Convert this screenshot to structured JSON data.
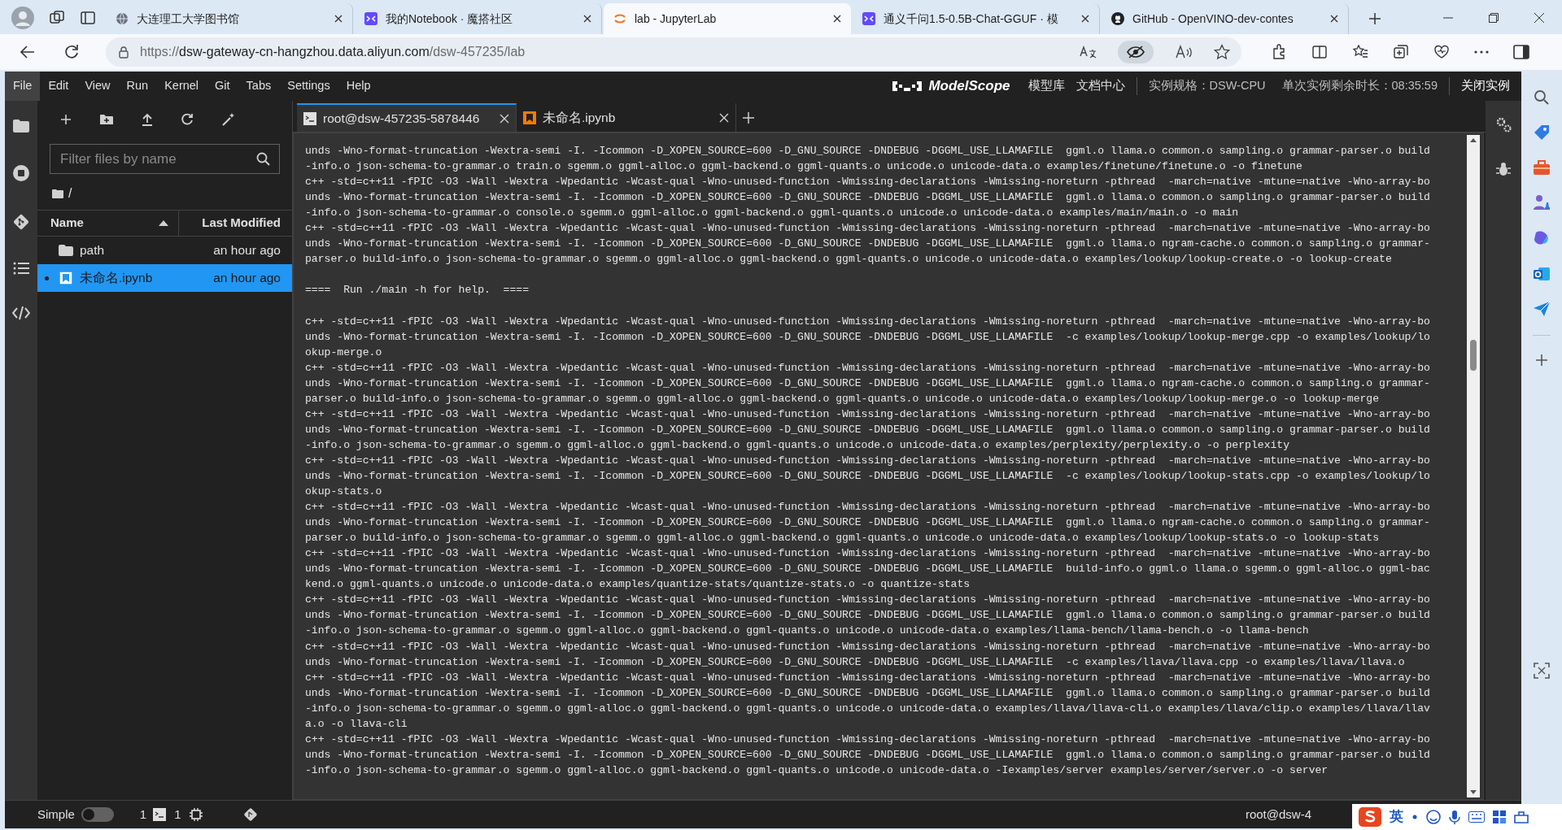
{
  "browser": {
    "tabs": [
      {
        "kind": "globe",
        "title": "大连理工大学图书馆",
        "selected": false
      },
      {
        "kind": "modelscope",
        "title": "我的Notebook · 魔搭社区",
        "selected": false
      },
      {
        "kind": "jupyter",
        "title": "lab - JupyterLab",
        "selected": true
      },
      {
        "kind": "modelscope",
        "title": "通义千问1.5-0.5B-Chat-GGUF · 模",
        "selected": false
      },
      {
        "kind": "github",
        "title": "GitHub - OpenVINO-dev-contes",
        "selected": false
      }
    ],
    "url": {
      "scheme": "https://",
      "host": "dsw-gateway-cn-hangzhou.data.aliyun.com",
      "path": "/dsw-457235/lab"
    }
  },
  "jupyter": {
    "menu": [
      {
        "label": "File",
        "selected": true
      },
      {
        "label": "Edit",
        "selected": false
      },
      {
        "label": "View",
        "selected": false
      },
      {
        "label": "Run",
        "selected": false
      },
      {
        "label": "Kernel",
        "selected": false
      },
      {
        "label": "Git",
        "selected": false
      },
      {
        "label": "Tabs",
        "selected": false
      },
      {
        "label": "Settings",
        "selected": false
      },
      {
        "label": "Help",
        "selected": false
      }
    ],
    "brand": {
      "logo_text": "ModelScope",
      "links": [
        "模型库",
        "文档中心"
      ],
      "instance_spec": "实例规格：DSW-CPU",
      "remaining_time": "单次实例剩余时长：08:35:59",
      "close_button": "关闭实例"
    },
    "file_browser": {
      "filter_placeholder": "Filter files by name",
      "path": "/",
      "columns": [
        "Name",
        "Last Modified"
      ],
      "files": [
        {
          "kind": "folder",
          "name": "path",
          "modified": "an hour ago",
          "selected": false,
          "running": false
        },
        {
          "kind": "notebook",
          "name": "未命名.ipynb",
          "modified": "an hour ago",
          "selected": true,
          "running": true
        }
      ]
    },
    "tabs": [
      {
        "kind": "terminal",
        "title": "root@dsw-457235-5878446",
        "selected": true
      },
      {
        "kind": "notebook",
        "title": "未命名.ipynb",
        "selected": false
      }
    ],
    "terminal": {
      "blocks": [
        [
          "unds -Wno-format-truncation -Wextra-semi -I. -Icommon -D_XOPEN_SOURCE=600 -D_GNU_SOURCE -DNDEBUG -DGGML_USE_LLAMAFILE  ggml.o llama.o common.o sampling.o grammar-parser.o build",
          "-info.o json-schema-to-grammar.o train.o sgemm.o ggml-alloc.o ggml-backend.o ggml-quants.o unicode.o unicode-data.o examples/finetune/finetune.o -o finetune",
          "c++ -std=c++11 -fPIC -O3 -Wall -Wextra -Wpedantic -Wcast-qual -Wno-unused-function -Wmissing-declarations -Wmissing-noreturn -pthread  -march=native -mtune=native -Wno-array-bo",
          "unds -Wno-format-truncation -Wextra-semi -I. -Icommon -D_XOPEN_SOURCE=600 -D_GNU_SOURCE -DNDEBUG -DGGML_USE_LLAMAFILE  ggml.o llama.o common.o sampling.o grammar-parser.o build",
          "-info.o json-schema-to-grammar.o console.o sgemm.o ggml-alloc.o ggml-backend.o ggml-quants.o unicode.o unicode-data.o examples/main/main.o -o main",
          "c++ -std=c++11 -fPIC -O3 -Wall -Wextra -Wpedantic -Wcast-qual -Wno-unused-function -Wmissing-declarations -Wmissing-noreturn -pthread  -march=native -mtune=native -Wno-array-bo",
          "unds -Wno-format-truncation -Wextra-semi -I. -Icommon -D_XOPEN_SOURCE=600 -D_GNU_SOURCE -DNDEBUG -DGGML_USE_LLAMAFILE  ggml.o llama.o ngram-cache.o common.o sampling.o grammar-",
          "parser.o build-info.o json-schema-to-grammar.o sgemm.o ggml-alloc.o ggml-backend.o ggml-quants.o unicode.o unicode-data.o examples/lookup/lookup-create.o -o lookup-create"
        ],
        [
          "====  Run ./main -h for help.  ===="
        ],
        [
          "c++ -std=c++11 -fPIC -O3 -Wall -Wextra -Wpedantic -Wcast-qual -Wno-unused-function -Wmissing-declarations -Wmissing-noreturn -pthread  -march=native -mtune=native -Wno-array-bo",
          "unds -Wno-format-truncation -Wextra-semi -I. -Icommon -D_XOPEN_SOURCE=600 -D_GNU_SOURCE -DNDEBUG -DGGML_USE_LLAMAFILE  -c examples/lookup/lookup-merge.cpp -o examples/lookup/lo",
          "okup-merge.o",
          "c++ -std=c++11 -fPIC -O3 -Wall -Wextra -Wpedantic -Wcast-qual -Wno-unused-function -Wmissing-declarations -Wmissing-noreturn -pthread  -march=native -mtune=native -Wno-array-bo",
          "unds -Wno-format-truncation -Wextra-semi -I. -Icommon -D_XOPEN_SOURCE=600 -D_GNU_SOURCE -DNDEBUG -DGGML_USE_LLAMAFILE  ggml.o llama.o ngram-cache.o common.o sampling.o grammar-",
          "parser.o build-info.o json-schema-to-grammar.o sgemm.o ggml-alloc.o ggml-backend.o ggml-quants.o unicode.o unicode-data.o examples/lookup/lookup-merge.o -o lookup-merge",
          "c++ -std=c++11 -fPIC -O3 -Wall -Wextra -Wpedantic -Wcast-qual -Wno-unused-function -Wmissing-declarations -Wmissing-noreturn -pthread  -march=native -mtune=native -Wno-array-bo",
          "unds -Wno-format-truncation -Wextra-semi -I. -Icommon -D_XOPEN_SOURCE=600 -D_GNU_SOURCE -DNDEBUG -DGGML_USE_LLAMAFILE  ggml.o llama.o common.o sampling.o grammar-parser.o build",
          "-info.o json-schema-to-grammar.o sgemm.o ggml-alloc.o ggml-backend.o ggml-quants.o unicode.o unicode-data.o examples/perplexity/perplexity.o -o perplexity",
          "c++ -std=c++11 -fPIC -O3 -Wall -Wextra -Wpedantic -Wcast-qual -Wno-unused-function -Wmissing-declarations -Wmissing-noreturn -pthread  -march=native -mtune=native -Wno-array-bo",
          "unds -Wno-format-truncation -Wextra-semi -I. -Icommon -D_XOPEN_SOURCE=600 -D_GNU_SOURCE -DNDEBUG -DGGML_USE_LLAMAFILE  -c examples/lookup/lookup-stats.cpp -o examples/lookup/lo",
          "okup-stats.o",
          "c++ -std=c++11 -fPIC -O3 -Wall -Wextra -Wpedantic -Wcast-qual -Wno-unused-function -Wmissing-declarations -Wmissing-noreturn -pthread  -march=native -mtune=native -Wno-array-bo",
          "unds -Wno-format-truncation -Wextra-semi -I. -Icommon -D_XOPEN_SOURCE=600 -D_GNU_SOURCE -DNDEBUG -DGGML_USE_LLAMAFILE  ggml.o llama.o ngram-cache.o common.o sampling.o grammar-",
          "parser.o build-info.o json-schema-to-grammar.o sgemm.o ggml-alloc.o ggml-backend.o ggml-quants.o unicode.o unicode-data.o examples/lookup/lookup-stats.o -o lookup-stats",
          "c++ -std=c++11 -fPIC -O3 -Wall -Wextra -Wpedantic -Wcast-qual -Wno-unused-function -Wmissing-declarations -Wmissing-noreturn -pthread  -march=native -mtune=native -Wno-array-bo",
          "unds -Wno-format-truncation -Wextra-semi -I. -Icommon -D_XOPEN_SOURCE=600 -D_GNU_SOURCE -DNDEBUG -DGGML_USE_LLAMAFILE  build-info.o ggml.o llama.o sgemm.o ggml-alloc.o ggml-bac",
          "kend.o ggml-quants.o unicode.o unicode-data.o examples/quantize-stats/quantize-stats.o -o quantize-stats",
          "c++ -std=c++11 -fPIC -O3 -Wall -Wextra -Wpedantic -Wcast-qual -Wno-unused-function -Wmissing-declarations -Wmissing-noreturn -pthread  -march=native -mtune=native -Wno-array-bo",
          "unds -Wno-format-truncation -Wextra-semi -I. -Icommon -D_XOPEN_SOURCE=600 -D_GNU_SOURCE -DNDEBUG -DGGML_USE_LLAMAFILE  ggml.o llama.o common.o sampling.o grammar-parser.o build",
          "-info.o json-schema-to-grammar.o sgemm.o ggml-alloc.o ggml-backend.o ggml-quants.o unicode.o unicode-data.o examples/llama-bench/llama-bench.o -o llama-bench",
          "c++ -std=c++11 -fPIC -O3 -Wall -Wextra -Wpedantic -Wcast-qual -Wno-unused-function -Wmissing-declarations -Wmissing-noreturn -pthread  -march=native -mtune=native -Wno-array-bo",
          "unds -Wno-format-truncation -Wextra-semi -I. -Icommon -D_XOPEN_SOURCE=600 -D_GNU_SOURCE -DNDEBUG -DGGML_USE_LLAMAFILE  -c examples/llava/llava.cpp -o examples/llava/llava.o",
          "c++ -std=c++11 -fPIC -O3 -Wall -Wextra -Wpedantic -Wcast-qual -Wno-unused-function -Wmissing-declarations -Wmissing-noreturn -pthread  -march=native -mtune=native -Wno-array-bo",
          "unds -Wno-format-truncation -Wextra-semi -I. -Icommon -D_XOPEN_SOURCE=600 -D_GNU_SOURCE -DNDEBUG -DGGML_USE_LLAMAFILE  ggml.o llama.o common.o sampling.o grammar-parser.o build",
          "-info.o json-schema-to-grammar.o sgemm.o ggml-alloc.o ggml-backend.o ggml-quants.o unicode.o unicode-data.o examples/llava/llava-cli.o examples/llava/clip.o examples/llava/llav",
          "a.o -o llava-cli",
          "c++ -std=c++11 -fPIC -O3 -Wall -Wextra -Wpedantic -Wcast-qual -Wno-unused-function -Wmissing-declarations -Wmissing-noreturn -pthread  -march=native -mtune=native -Wno-array-bo",
          "unds -Wno-format-truncation -Wextra-semi -I. -Icommon -D_XOPEN_SOURCE=600 -D_GNU_SOURCE -DNDEBUG -DGGML_USE_LLAMAFILE  ggml.o llama.o common.o sampling.o grammar-parser.o build",
          "-info.o json-schema-to-grammar.o sgemm.o ggml-alloc.o ggml-backend.o ggml-quants.o unicode.o unicode-data.o -Iexamples/server examples/server/server.o -o server"
        ]
      ]
    },
    "status_bar": {
      "mode_label": "Simple",
      "simple_on": false,
      "terminals_count": "1",
      "kernels_count": "1",
      "terminal_title": "root@dsw-4"
    }
  },
  "ime": {
    "language": "英"
  }
}
